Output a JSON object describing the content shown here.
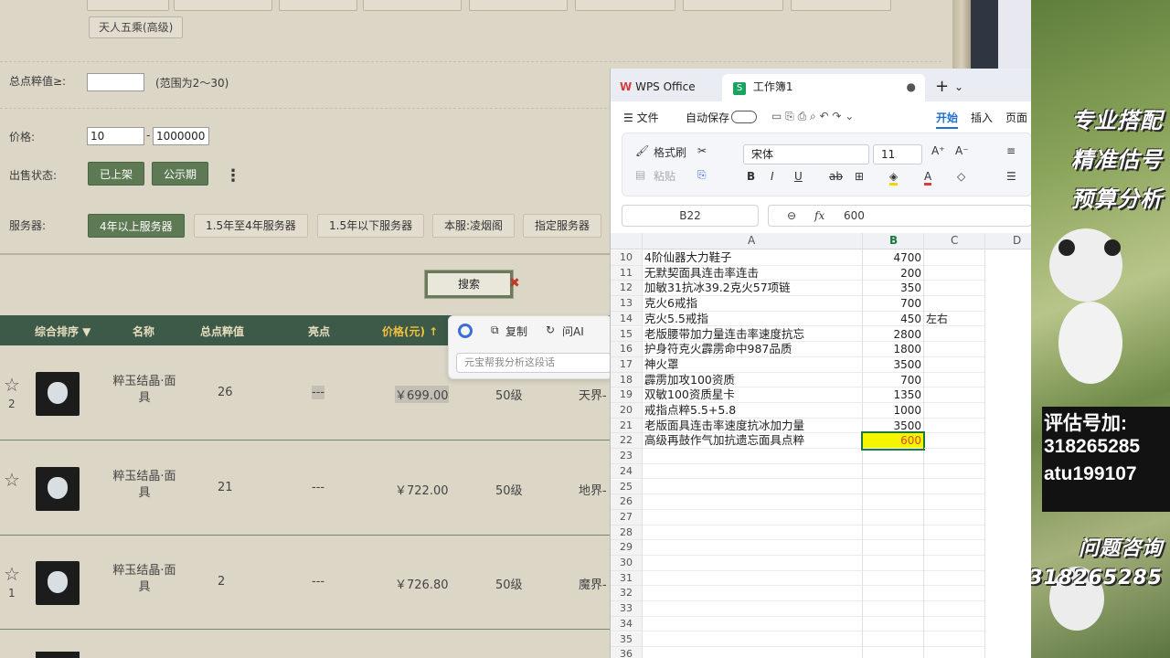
{
  "game": {
    "top_tag": "天人五乘(高级)",
    "total_points_label": "总点粹值≥:",
    "total_points_value": "",
    "total_points_hint": "(范围为2～30)",
    "price_label": "价格:",
    "price_min": "10",
    "price_sep": "-",
    "price_max": "1000000",
    "sale_status_label": "出售状态:",
    "sale_status_options": [
      "已上架",
      "公示期"
    ],
    "more_glyph": "⋮",
    "server_label": "服务器:",
    "server_options": [
      "4年以上服务器",
      "1.5年至4年服务器",
      "1.5年以下服务器",
      "本服:凌烟阁",
      "指定服务器"
    ],
    "search_label": "搜索",
    "search_close": "✖",
    "table_headers": {
      "sort": "综合排序 ▼",
      "name": "名称",
      "points": "总点粹值",
      "highlight": "亮点",
      "price": "价格(元) ↑"
    },
    "rows": [
      {
        "favorites": "2",
        "name": "粹玉结晶·面具",
        "points": "26",
        "highlight": "---",
        "price": "￥699.00",
        "level": "50级",
        "server": "天界-"
      },
      {
        "favorites": "",
        "name": "粹玉结晶·面具",
        "points": "21",
        "highlight": "---",
        "price": "￥722.00",
        "level": "50级",
        "server": "地界-"
      },
      {
        "favorites": "1",
        "name": "粹玉结晶·面具",
        "points": "2",
        "highlight": "---",
        "price": "￥726.80",
        "level": "50级",
        "server": "魔界-"
      }
    ]
  },
  "ai_bar": {
    "copy": "复制",
    "ask_ai": "问AI",
    "placeholder": "元宝帮我分析这段话"
  },
  "wps": {
    "tab_office": "WPS Office",
    "tab_sheet": "工作簿1",
    "menu": {
      "hamburger": "☰ 文件",
      "autosave": "自动保存",
      "start": "开始",
      "insert": "插入",
      "page": "页面"
    },
    "ribbon": {
      "format_painter": "格式刷",
      "paste": "粘贴",
      "font": "宋体",
      "size": "11"
    },
    "name_box": "B22",
    "formula_value": "600",
    "fx": "fx",
    "columns": [
      "A",
      "B",
      "C",
      "D"
    ],
    "rows": [
      {
        "n": "10",
        "a": "4阶仙器大力鞋子",
        "b": "4700",
        "c": ""
      },
      {
        "n": "11",
        "a": "无默契面具连击率连击",
        "b": "200",
        "c": ""
      },
      {
        "n": "12",
        "a": "加敏31抗冰39.2克火57项链",
        "b": "350",
        "c": ""
      },
      {
        "n": "13",
        "a": "克火6戒指",
        "b": "700",
        "c": ""
      },
      {
        "n": "14",
        "a": "克火5.5戒指",
        "b": "450",
        "c": "左右"
      },
      {
        "n": "15",
        "a": "老版腰带加力量连击率速度抗忘",
        "b": "2800",
        "c": ""
      },
      {
        "n": "16",
        "a": "护身符克火霹雳命中987品质",
        "b": "1800",
        "c": ""
      },
      {
        "n": "17",
        "a": "神火罩",
        "b": "3500",
        "c": ""
      },
      {
        "n": "18",
        "a": "霹雳加攻100资质",
        "b": "700",
        "c": ""
      },
      {
        "n": "19",
        "a": "双敏100资质星卡",
        "b": "1350",
        "c": ""
      },
      {
        "n": "20",
        "a": "戒指点粹5.5+5.8",
        "b": "1000",
        "c": ""
      },
      {
        "n": "21",
        "a": "老版面具连击率速度抗冰加力量",
        "b": "3500",
        "c": ""
      },
      {
        "n": "22",
        "a": "高级再鼓作气加抗遗忘面具点粹",
        "b": "600",
        "c": ""
      },
      {
        "n": "23",
        "a": "",
        "b": "",
        "c": ""
      },
      {
        "n": "24",
        "a": "",
        "b": "",
        "c": ""
      },
      {
        "n": "25",
        "a": "",
        "b": "",
        "c": ""
      },
      {
        "n": "26",
        "a": "",
        "b": "",
        "c": ""
      },
      {
        "n": "27",
        "a": "",
        "b": "",
        "c": ""
      },
      {
        "n": "28",
        "a": "",
        "b": "",
        "c": ""
      },
      {
        "n": "29",
        "a": "",
        "b": "",
        "c": ""
      },
      {
        "n": "30",
        "a": "",
        "b": "",
        "c": ""
      },
      {
        "n": "31",
        "a": "",
        "b": "",
        "c": ""
      },
      {
        "n": "32",
        "a": "",
        "b": "",
        "c": ""
      },
      {
        "n": "33",
        "a": "",
        "b": "",
        "c": ""
      },
      {
        "n": "34",
        "a": "",
        "b": "",
        "c": ""
      },
      {
        "n": "35",
        "a": "",
        "b": "",
        "c": ""
      },
      {
        "n": "36",
        "a": "",
        "b": "",
        "c": ""
      }
    ],
    "selected_fill": "#f5f500",
    "selected_text": "#e0462a"
  },
  "ad": {
    "line1": "专业搭配",
    "line2": "精准估号",
    "line3": "预算分析",
    "contact_title": "评估号加:",
    "contact_qq": "318265285",
    "contact_id": "atu199107",
    "consult": "问题咨询",
    "consult_qq": "318265285"
  }
}
